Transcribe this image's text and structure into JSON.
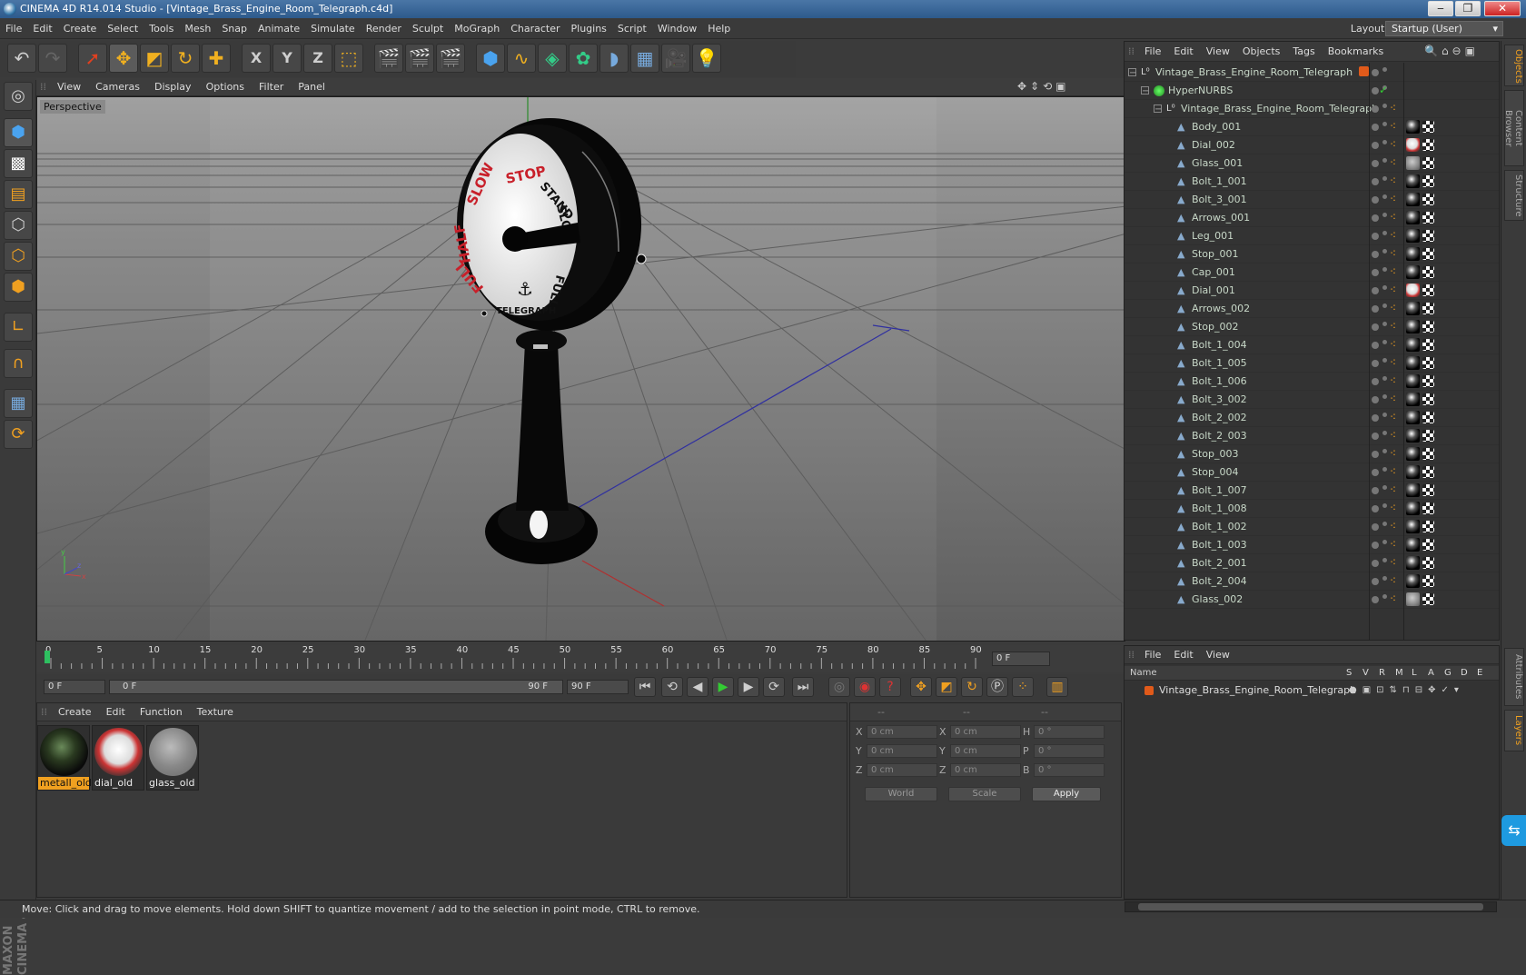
{
  "window": {
    "title": "CINEMA 4D R14.014 Studio - [Vintage_Brass_Engine_Room_Telegraph.c4d]",
    "minimize": "‒",
    "maximize": "❐",
    "close": "✕"
  },
  "menu": [
    "File",
    "Edit",
    "Create",
    "Select",
    "Tools",
    "Mesh",
    "Snap",
    "Animate",
    "Simulate",
    "Render",
    "Sculpt",
    "MoGraph",
    "Character",
    "Plugins",
    "Script",
    "Window",
    "Help"
  ],
  "layout": {
    "label": "Layout:",
    "value": "Startup (User)"
  },
  "toolbar": {
    "axis_x": "X",
    "axis_y": "Y",
    "axis_z": "Z"
  },
  "viewport": {
    "menu": [
      "View",
      "Cameras",
      "Display",
      "Options",
      "Filter",
      "Panel"
    ],
    "label": "Perspective"
  },
  "timeline": {
    "ticks": [
      "0",
      "5",
      "10",
      "15",
      "20",
      "25",
      "30",
      "35",
      "40",
      "45",
      "50",
      "55",
      "60",
      "65",
      "70",
      "75",
      "80",
      "85",
      "90"
    ],
    "current_frame": "0 F",
    "start_frame": "0 F",
    "range_start": "0 F",
    "range_end": "90 F",
    "end_frame": "90 F"
  },
  "materials": {
    "menu": [
      "Create",
      "Edit",
      "Function",
      "Texture"
    ],
    "items": [
      {
        "name": "metall_old",
        "selected": true
      },
      {
        "name": "dial_old",
        "selected": false
      },
      {
        "name": "glass_old",
        "selected": false
      }
    ]
  },
  "coords": {
    "header": [
      "--",
      "--",
      "--"
    ],
    "rows": [
      {
        "a": "X",
        "av": "0 cm",
        "b": "X",
        "bv": "0 cm",
        "c": "H",
        "cv": "0 °"
      },
      {
        "a": "Y",
        "av": "0 cm",
        "b": "Y",
        "bv": "0 cm",
        "c": "P",
        "cv": "0 °"
      },
      {
        "a": "Z",
        "av": "0 cm",
        "b": "Z",
        "bv": "0 cm",
        "c": "B",
        "cv": "0 °"
      }
    ],
    "world": "World",
    "scale": "Scale",
    "apply": "Apply"
  },
  "objects": {
    "menu": [
      "File",
      "Edit",
      "View",
      "Objects",
      "Tags",
      "Bookmarks"
    ],
    "root": "Vintage_Brass_Engine_Room_Telegraph",
    "hypernurbs": "HyperNURBS",
    "group": "Vintage_Brass_Engine_Room_Telegraph",
    "children": [
      {
        "name": "Body_001",
        "mat": "metal"
      },
      {
        "name": "Dial_002",
        "mat": "dial"
      },
      {
        "name": "Glass_001",
        "mat": "glass"
      },
      {
        "name": "Bolt_1_001",
        "mat": "metal"
      },
      {
        "name": "Bolt_3_001",
        "mat": "metal"
      },
      {
        "name": "Arrows_001",
        "mat": "metal"
      },
      {
        "name": "Leg_001",
        "mat": "metal"
      },
      {
        "name": "Stop_001",
        "mat": "metal"
      },
      {
        "name": "Cap_001",
        "mat": "metal"
      },
      {
        "name": "Dial_001",
        "mat": "dial"
      },
      {
        "name": "Arrows_002",
        "mat": "metal"
      },
      {
        "name": "Stop_002",
        "mat": "metal"
      },
      {
        "name": "Bolt_1_004",
        "mat": "metal"
      },
      {
        "name": "Bolt_1_005",
        "mat": "metal"
      },
      {
        "name": "Bolt_1_006",
        "mat": "metal"
      },
      {
        "name": "Bolt_3_002",
        "mat": "metal"
      },
      {
        "name": "Bolt_2_002",
        "mat": "metal"
      },
      {
        "name": "Bolt_2_003",
        "mat": "metal"
      },
      {
        "name": "Stop_003",
        "mat": "metal"
      },
      {
        "name": "Stop_004",
        "mat": "metal"
      },
      {
        "name": "Bolt_1_007",
        "mat": "metal"
      },
      {
        "name": "Bolt_1_008",
        "mat": "metal"
      },
      {
        "name": "Bolt_1_002",
        "mat": "metal"
      },
      {
        "name": "Bolt_1_003",
        "mat": "metal"
      },
      {
        "name": "Bolt_2_001",
        "mat": "metal"
      },
      {
        "name": "Bolt_2_004",
        "mat": "metal"
      },
      {
        "name": "Glass_002",
        "mat": "glass"
      }
    ]
  },
  "layers": {
    "menu": [
      "File",
      "Edit",
      "View"
    ],
    "name_header": "Name",
    "columns": [
      "S",
      "V",
      "R",
      "M",
      "L",
      "A",
      "G",
      "D",
      "E"
    ],
    "row": "Vintage_Brass_Engine_Room_Telegraph"
  },
  "right_tabs": [
    "Objects",
    "Content Browser",
    "Structure",
    "Attributes",
    "Layers"
  ],
  "brand": "MAXON CINEMA 4D",
  "status": "Move: Click and drag to move elements. Hold down SHIFT to quantize movement / add to the selection in point mode, CTRL to remove.",
  "colors": {
    "accent": "#e8820f",
    "selected_material": "#f0a020",
    "title_blue": "#3a6a9c"
  }
}
